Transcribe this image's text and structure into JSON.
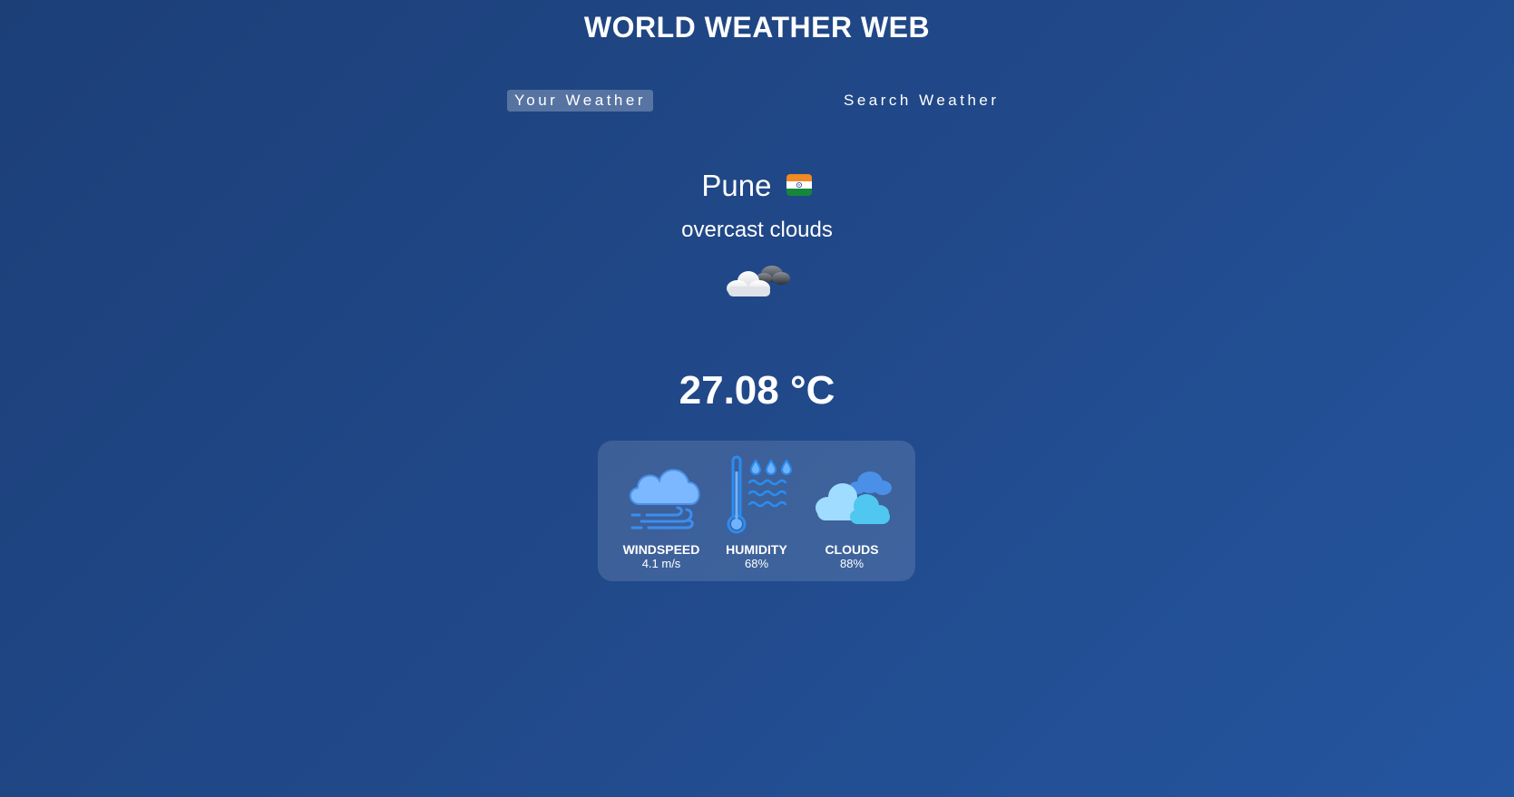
{
  "app": {
    "title": "WORLD WEATHER WEB"
  },
  "tabs": [
    {
      "label": "Your Weather",
      "active": true
    },
    {
      "label": "Search Weather",
      "active": false
    }
  ],
  "weather": {
    "city": "Pune",
    "country_flag": "india-flag",
    "description": "overcast clouds",
    "icon": "overcast-cloud-icon",
    "temperature": "27.08 °C"
  },
  "stats": [
    {
      "label": "WINDSPEED",
      "value": "4.1 m/s",
      "icon": "wind-icon"
    },
    {
      "label": "HUMIDITY",
      "value": "68%",
      "icon": "humidity-thermometer-icon"
    },
    {
      "label": "CLOUDS",
      "value": "88%",
      "icon": "clouds-icon"
    }
  ],
  "colors": {
    "background_start": "#1c3f78",
    "background_end": "#24559f",
    "card_background": "rgba(255,255,255,0.13)",
    "icon_blue": "#2b8cf0",
    "icon_light_blue": "#6fb3ff",
    "icon_cyan": "#5fd0f5"
  }
}
